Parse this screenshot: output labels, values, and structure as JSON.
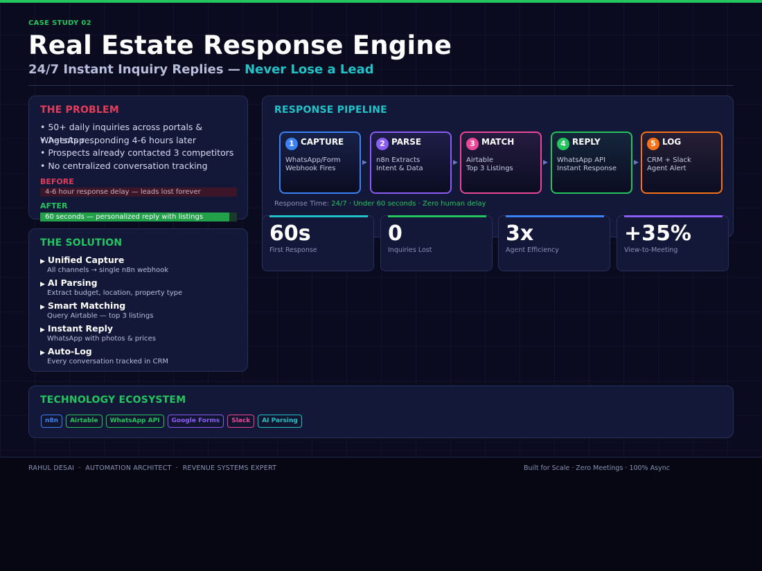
{
  "header": {
    "eyebrow": "CASE STUDY 02",
    "title": "Real Estate Response Engine",
    "subtitle_main": "24/7 Instant Inquiry Replies — ",
    "subtitle_accent": "Never Lose a Lead"
  },
  "problem": {
    "title": "THE PROBLEM",
    "bullets": [
      "• 50+ daily inquiries across portals & WhatsApp",
      "• Agents responding 4-6 hours later",
      "• Prospects already contacted 3 competitors",
      "• No centralized conversation tracking"
    ],
    "before_label": "BEFORE",
    "before_text": "4-6 hour response delay — leads lost forever",
    "after_label": "AFTER",
    "after_text": "60 seconds — personalized reply with listings",
    "after_fill": 0.96
  },
  "solution": {
    "title": "THE SOLUTION",
    "items": [
      {
        "head": "Unified Capture",
        "desc": "All channels → single n8n webhook"
      },
      {
        "head": "AI Parsing",
        "desc": "Extract budget, location, property type"
      },
      {
        "head": "Smart Matching",
        "desc": "Query Airtable — top 3 listings"
      },
      {
        "head": "Instant Reply",
        "desc": "WhatsApp with photos & prices"
      },
      {
        "head": "Auto-Log",
        "desc": "Every conversation tracked in CRM"
      }
    ]
  },
  "pipeline": {
    "title": "RESPONSE PIPELINE",
    "steps": [
      {
        "num": "1",
        "name": "CAPTURE",
        "line1": "WhatsApp/Form",
        "line2": "Webhook Fires",
        "color": "#3b82f6"
      },
      {
        "num": "2",
        "name": "PARSE",
        "line1": "n8n Extracts",
        "line2": "Intent & Data",
        "color": "#8b5cf6"
      },
      {
        "num": "3",
        "name": "MATCH",
        "line1": "Airtable",
        "line2": "Top 3 Listings",
        "color": "#ec4899"
      },
      {
        "num": "4",
        "name": "REPLY",
        "line1": "WhatsApp API",
        "line2": "Instant Response",
        "color": "#22c55e"
      },
      {
        "num": "5",
        "name": "LOG",
        "line1": "CRM + Slack",
        "line2": "Agent Alert",
        "color": "#f97316"
      }
    ],
    "response_label": "Response Time: ",
    "response_value": "24/7 · Under 60 seconds · Zero human delay"
  },
  "stats": [
    {
      "value": "60s",
      "label": "First Response",
      "color": "#22c3c8"
    },
    {
      "value": "0",
      "label": "Inquiries Lost",
      "color": "#22c55e"
    },
    {
      "value": "3x",
      "label": "Agent Efficiency",
      "color": "#3b82f6"
    },
    {
      "value": "+35%",
      "label": "View-to-Meeting",
      "color": "#8b5cf6"
    }
  ],
  "tech": {
    "title": "TECHNOLOGY ECOSYSTEM",
    "tags": [
      {
        "label": "n8n",
        "color": "#3b82f6"
      },
      {
        "label": "Airtable",
        "color": "#22c55e"
      },
      {
        "label": "WhatsApp API",
        "color": "#22c55e"
      },
      {
        "label": "Google Forms",
        "color": "#8b5cf6"
      },
      {
        "label": "Slack",
        "color": "#ec4899"
      },
      {
        "label": "AI Parsing",
        "color": "#22c3c8"
      }
    ]
  },
  "footer": {
    "left": "RAHUL DESAI  ·  AUTOMATION ARCHITECT  ·  REVENUE SYSTEMS EXPERT",
    "right": "Built for Scale · Zero Meetings · 100% Async"
  },
  "colors": {
    "accent_green": "#22c55e",
    "accent_red": "#e43d5a",
    "accent_teal": "#22c3c8"
  }
}
